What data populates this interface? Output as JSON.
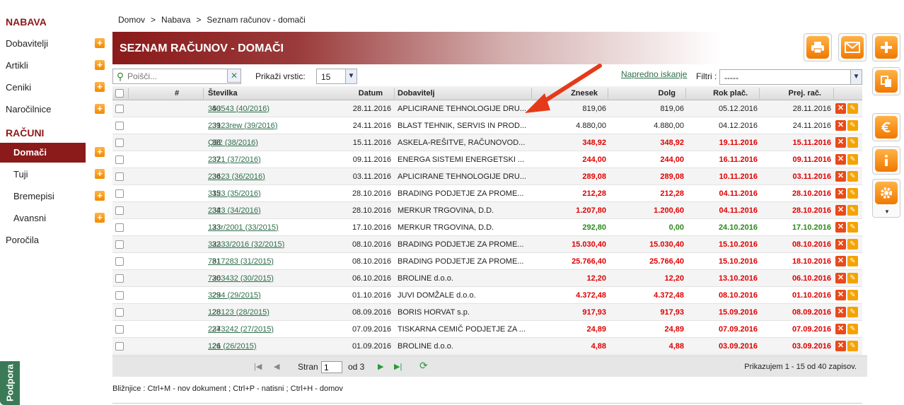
{
  "sidebar": {
    "section1": "NABAVA",
    "items1": [
      {
        "label": "Dobavitelji",
        "plus": "+"
      },
      {
        "label": "Artikli",
        "plus": "+"
      },
      {
        "label": "Ceniki",
        "plus": "+"
      },
      {
        "label": "Naročilnice",
        "plus": "+"
      }
    ],
    "section2": "RAČUNI",
    "items2": [
      {
        "label": "Domači",
        "plus": "+"
      },
      {
        "label": "Tuji",
        "plus": "+"
      },
      {
        "label": "Bremepisi",
        "plus": "+"
      },
      {
        "label": "Avansni",
        "plus": "+"
      }
    ],
    "reports": "Poročila",
    "support_tab": "Podpora"
  },
  "breadcrumb": [
    "Domov",
    ">",
    "Nabava",
    ">",
    "Seznam računov - domači"
  ],
  "title": "SEZNAM RAČUNOV - DOMAČI",
  "toolbar": {
    "search_placeholder": "Poišči...",
    "rows_label": "Prikaži vrstic:",
    "rows_value": "15",
    "advanced_search": "Napredno iskanje",
    "filter_label": "Filtri :",
    "filter_value": "-----"
  },
  "table": {
    "headers": {
      "num": "#",
      "stevilka": "Številka",
      "datum": "Datum",
      "dobavitelj": "Dobavitelj",
      "znesek": "Znesek",
      "dolg": "Dolg",
      "rok": "Rok plač.",
      "prej": "Prej. rač."
    },
    "rows": [
      {
        "num": "40",
        "stevilka": "353543 (40/2016)",
        "datum": "28.11.2016",
        "dobavitelj": "APLICIRANE TEHNOLOGIJE DRU...",
        "znesek": "819,06",
        "dolg": "819,06",
        "rok": "05.12.2016",
        "prej": "28.11.2016",
        "style": "normal"
      },
      {
        "num": "39",
        "stevilka": "23123rew (39/2016)",
        "datum": "24.11.2016",
        "dobavitelj": "BLAST TEHNIK, SERVIS IN PROD...",
        "znesek": "4.880,00",
        "dolg": "4.880,00",
        "rok": "04.12.2016",
        "prej": "24.11.2016",
        "style": "normal"
      },
      {
        "num": "38",
        "stevilka": "Q32 (38/2016)",
        "datum": "15.11.2016",
        "dobavitelj": "ASKELA-REŠITVE, RAČUNOVOD...",
        "znesek": "348,92",
        "dolg": "348,92",
        "rok": "19.11.2016",
        "prej": "15.11.2016",
        "style": "red"
      },
      {
        "num": "37",
        "stevilka": "2321 (37/2016)",
        "datum": "09.11.2016",
        "dobavitelj": "ENERGA SISTEMI ENERGETSKI ...",
        "znesek": "244,00",
        "dolg": "244,00",
        "rok": "16.11.2016",
        "prej": "09.11.2016",
        "style": "red"
      },
      {
        "num": "36",
        "stevilka": "23423 (36/2016)",
        "datum": "03.11.2016",
        "dobavitelj": "APLICIRANE TEHNOLOGIJE DRU...",
        "znesek": "289,08",
        "dolg": "289,08",
        "rok": "10.11.2016",
        "prej": "03.11.2016",
        "style": "red"
      },
      {
        "num": "35",
        "stevilka": "3123 (35/2016)",
        "datum": "28.10.2016",
        "dobavitelj": "BRADING PODJETJE ZA PROME...",
        "znesek": "212,28",
        "dolg": "212,28",
        "rok": "04.11.2016",
        "prej": "28.10.2016",
        "style": "red"
      },
      {
        "num": "34",
        "stevilka": "2323 (34/2016)",
        "datum": "28.10.2016",
        "dobavitelj": "MERKUR TRGOVINA, D.D.",
        "znesek": "1.207,80",
        "dolg": "1.200,60",
        "rok": "04.11.2016",
        "prej": "28.10.2016",
        "style": "red"
      },
      {
        "num": "33",
        "stevilka": "123r/2001 (33/2015)",
        "datum": "17.10.2016",
        "dobavitelj": "MERKUR TRGOVINA, D.D.",
        "znesek": "292,80",
        "dolg": "0,00",
        "rok": "24.10.2016",
        "prej": "17.10.2016",
        "style": "green"
      },
      {
        "num": "32",
        "stevilka": "32333/2016 (32/2015)",
        "datum": "08.10.2016",
        "dobavitelj": "BRADING PODJETJE ZA PROME...",
        "znesek": "15.030,40",
        "dolg": "15.030,40",
        "rok": "15.10.2016",
        "prej": "08.10.2016",
        "style": "red"
      },
      {
        "num": "31",
        "stevilka": "7617283 (31/2015)",
        "datum": "08.10.2016",
        "dobavitelj": "BRADING PODJETJE ZA PROME...",
        "znesek": "25.766,40",
        "dolg": "25.766,40",
        "rok": "15.10.2016",
        "prej": "18.10.2016",
        "style": "red"
      },
      {
        "num": "30",
        "stevilka": "7263432 (30/2015)",
        "datum": "06.10.2016",
        "dobavitelj": "BROLINE d.o.o.",
        "znesek": "12,20",
        "dolg": "12,20",
        "rok": "13.10.2016",
        "prej": "06.10.2016",
        "style": "red"
      },
      {
        "num": "29",
        "stevilka": "3234 (29/2015)",
        "datum": "01.10.2016",
        "dobavitelj": "JUVI DOMŽALE d.o.o.",
        "znesek": "4.372,48",
        "dolg": "4.372,48",
        "rok": "08.10.2016",
        "prej": "01.10.2016",
        "style": "red"
      },
      {
        "num": "28",
        "stevilka": "123123 (28/2015)",
        "datum": "08.09.2016",
        "dobavitelj": "BORIS HORVAT s.p.",
        "znesek": "917,93",
        "dolg": "917,93",
        "rok": "15.09.2016",
        "prej": "08.09.2016",
        "style": "red"
      },
      {
        "num": "27",
        "stevilka": "2343242 (27/2015)",
        "datum": "07.09.2016",
        "dobavitelj": "TISKARNA CEMIČ PODJETJE ZA ...",
        "znesek": "24,89",
        "dolg": "24,89",
        "rok": "07.09.2016",
        "prej": "07.09.2016",
        "style": "red"
      },
      {
        "num": "26",
        "stevilka": "121 (26/2015)",
        "datum": "01.09.2016",
        "dobavitelj": "BROLINE d.o.o.",
        "znesek": "4,88",
        "dolg": "4,88",
        "rok": "03.09.2016",
        "prej": "03.09.2016",
        "style": "red"
      }
    ]
  },
  "pager": {
    "page_label": "Stran",
    "page_value": "1",
    "of_label": "od 3",
    "summary": "Prikazujem 1 - 15 od 40 zapisov."
  },
  "shortcuts": "Bližnjice : Ctrl+M - nov dokument ;  Ctrl+P - natisni ;  Ctrl+H - domov",
  "colors": {
    "brand": "#8b1a1a",
    "accent": "#f28a00",
    "overdue": "#e00000",
    "paid": "#2a8a1a",
    "link": "#2e6e4a"
  }
}
